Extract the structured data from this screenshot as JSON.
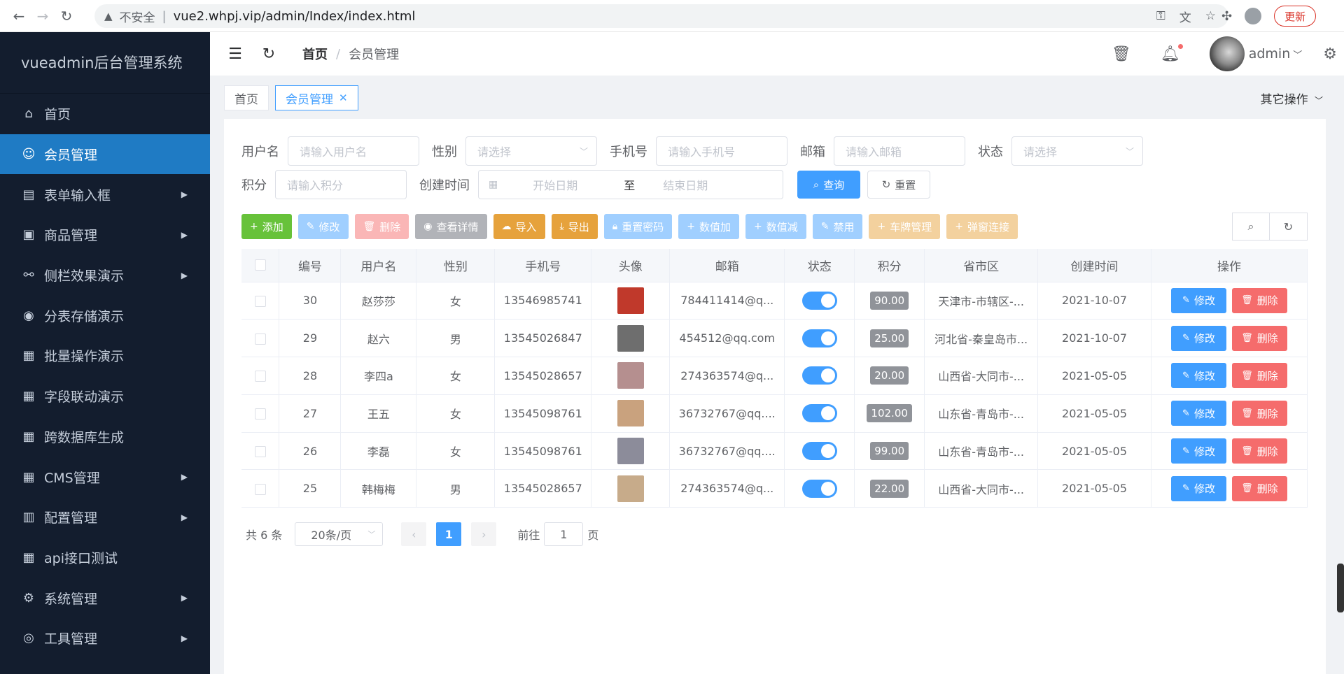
{
  "browser": {
    "insecure_label": "不安全",
    "url": "vue2.whpj.vip/admin/Index/index.html",
    "update_label": "更新"
  },
  "sidebar": {
    "title": "vueadmin后台管理系统",
    "items": [
      {
        "label": "首页",
        "icon": "home-icon",
        "active": false,
        "has_children": false
      },
      {
        "label": "会员管理",
        "icon": "user-icon",
        "active": true,
        "has_children": false
      },
      {
        "label": "表单输入框",
        "icon": "briefcase-icon",
        "active": false,
        "has_children": true
      },
      {
        "label": "商品管理",
        "icon": "bag-icon",
        "active": false,
        "has_children": true
      },
      {
        "label": "侧栏效果演示",
        "icon": "link-icon",
        "active": false,
        "has_children": true
      },
      {
        "label": "分表存储演示",
        "icon": "circle-icon",
        "active": false,
        "has_children": false
      },
      {
        "label": "批量操作演示",
        "icon": "grid-icon",
        "active": false,
        "has_children": false
      },
      {
        "label": "字段联动演示",
        "icon": "grid-icon",
        "active": false,
        "has_children": false
      },
      {
        "label": "跨数据库生成",
        "icon": "grid-icon",
        "active": false,
        "has_children": false
      },
      {
        "label": "CMS管理",
        "icon": "grid-icon",
        "active": false,
        "has_children": true
      },
      {
        "label": "配置管理",
        "icon": "bar-chart-icon",
        "active": false,
        "has_children": true
      },
      {
        "label": "api接口测试",
        "icon": "grid-icon",
        "active": false,
        "has_children": false
      },
      {
        "label": "系统管理",
        "icon": "gear-icon",
        "active": false,
        "has_children": true
      },
      {
        "label": "工具管理",
        "icon": "target-icon",
        "active": false,
        "has_children": true
      }
    ]
  },
  "header": {
    "breadcrumb_home": "首页",
    "breadcrumb_current": "会员管理",
    "username": "admin"
  },
  "tabs": {
    "home": "首页",
    "current": "会员管理",
    "other_ops": "其它操作"
  },
  "search": {
    "username_label": "用户名",
    "username_placeholder": "请输入用户名",
    "sex_label": "性别",
    "sex_placeholder": "请选择",
    "mobile_label": "手机号",
    "mobile_placeholder": "请输入手机号",
    "email_label": "邮箱",
    "email_placeholder": "请输入邮箱",
    "status_label": "状态",
    "status_placeholder": "请选择",
    "score_label": "积分",
    "score_placeholder": "请输入积分",
    "created_label": "创建时间",
    "start_placeholder": "开始日期",
    "range_sep": "至",
    "end_placeholder": "结束日期",
    "query_label": "查询",
    "reset_label": "重置"
  },
  "toolbar": {
    "buttons": [
      {
        "label": "添加",
        "icon": "plus-icon",
        "color": "#67c23a"
      },
      {
        "label": "修改",
        "icon": "edit-icon",
        "color": "#a0cfff"
      },
      {
        "label": "删除",
        "icon": "trash-icon",
        "color": "#fab6b6"
      },
      {
        "label": "查看详情",
        "icon": "eye-icon",
        "color": "#b1b3b8"
      },
      {
        "label": "导入",
        "icon": "upload-icon",
        "color": "#e6a23c"
      },
      {
        "label": "导出",
        "icon": "download-icon",
        "color": "#e6a23c"
      },
      {
        "label": "重置密码",
        "icon": "lock-icon",
        "color": "#a0cfff"
      },
      {
        "label": "数值加",
        "icon": "plus-icon",
        "color": "#a0cfff"
      },
      {
        "label": "数值减",
        "icon": "plus-icon",
        "color": "#a0cfff"
      },
      {
        "label": "禁用",
        "icon": "edit-icon",
        "color": "#a0cfff"
      },
      {
        "label": "车牌管理",
        "icon": "plus-icon",
        "color": "#f3d19e"
      },
      {
        "label": "弹窗连接",
        "icon": "plus-icon",
        "color": "#f3d19e"
      }
    ]
  },
  "table": {
    "headers": [
      "编号",
      "用户名",
      "性别",
      "手机号",
      "头像",
      "邮箱",
      "状态",
      "积分",
      "省市区",
      "创建时间",
      "操作"
    ],
    "edit_label": "修改",
    "delete_label": "删除",
    "rows": [
      {
        "id": "30",
        "username": "赵莎莎",
        "sex": "女",
        "mobile": "13546985741",
        "avatar": "#c0392b",
        "email": "784411414@q...",
        "status": true,
        "score": "90.00",
        "region": "天津市-市辖区-...",
        "created": "2021-10-07"
      },
      {
        "id": "29",
        "username": "赵六",
        "sex": "男",
        "mobile": "13545026847",
        "avatar": "#6e6e6e",
        "email": "454512@qq.com",
        "status": true,
        "score": "25.00",
        "region": "河北省-秦皇岛市...",
        "created": "2021-10-07"
      },
      {
        "id": "28",
        "username": "李四a",
        "sex": "女",
        "mobile": "13545028657",
        "avatar": "#b58f8f",
        "email": "274363574@q...",
        "status": true,
        "score": "20.00",
        "region": "山西省-大同市-...",
        "created": "2021-05-05"
      },
      {
        "id": "27",
        "username": "王五",
        "sex": "女",
        "mobile": "13545098761",
        "avatar": "#c9a27e",
        "email": "36732767@qq....",
        "status": true,
        "score": "102.00",
        "region": "山东省-青岛市-...",
        "created": "2021-05-05"
      },
      {
        "id": "26",
        "username": "李磊",
        "sex": "女",
        "mobile": "13545098761",
        "avatar": "#8c8c9a",
        "email": "36732767@qq....",
        "status": true,
        "score": "99.00",
        "region": "山东省-青岛市-...",
        "created": "2021-05-05"
      },
      {
        "id": "25",
        "username": "韩梅梅",
        "sex": "男",
        "mobile": "13545028657",
        "avatar": "#c7ab8a",
        "email": "274363574@q...",
        "status": true,
        "score": "22.00",
        "region": "山西省-大同市-...",
        "created": "2021-05-05"
      }
    ]
  },
  "pagination": {
    "total_text": "共 6 条",
    "page_size": "20条/页",
    "current_page": "1",
    "goto_label": "前往",
    "goto_value": "1",
    "page_unit": "页"
  }
}
